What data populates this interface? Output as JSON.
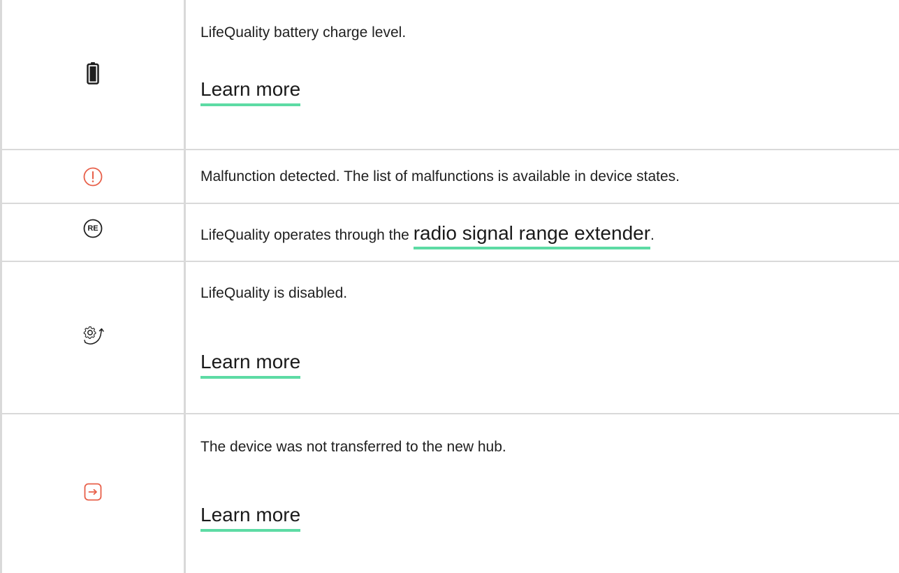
{
  "rows": [
    {
      "icon": "battery-icon",
      "description": "LifeQuality battery charge level.",
      "link_label": "Learn more"
    },
    {
      "icon": "malfunction-alert-icon",
      "description": "Malfunction detected. The list of malfunctions is available in device states."
    },
    {
      "icon": "range-extender-icon",
      "icon_text": "RE",
      "description_prefix": "LifeQuality operates through the ",
      "link_label": "radio signal range extender",
      "description_suffix": "."
    },
    {
      "icon": "device-disabled-icon",
      "description": "LifeQuality is disabled.",
      "link_label": "Learn more"
    },
    {
      "icon": "not-transferred-icon",
      "description": "The device was not transferred to the new hub.",
      "link_label": "Learn more"
    }
  ],
  "colors": {
    "accent_underline": "#5ddba4",
    "alert_red": "#e8604a",
    "border": "#d9d9d9",
    "text": "#1f1f1f"
  }
}
